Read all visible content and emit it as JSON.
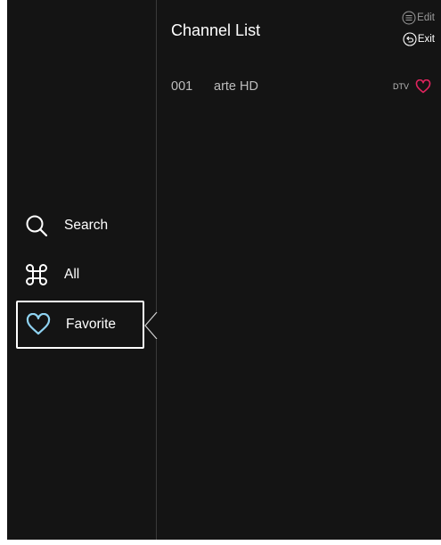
{
  "sidebar": {
    "items": [
      {
        "label": "Search",
        "icon": "search-icon",
        "selected": false
      },
      {
        "label": "All",
        "icon": "command-icon",
        "selected": false
      },
      {
        "label": "Favorite",
        "icon": "heart-icon",
        "selected": true
      }
    ]
  },
  "main": {
    "title": "Channel List",
    "hints": {
      "edit": "Edit",
      "exit": "Exit"
    },
    "channels": [
      {
        "number": "001",
        "name": "arte HD",
        "type": "DTV",
        "favorite": true
      }
    ]
  },
  "colors": {
    "background": "#141414",
    "favorite_accent": "#e0245e",
    "selected_icon": "#8fd3f2",
    "text_primary": "#ffffff",
    "text_secondary": "#bdbdbd"
  }
}
